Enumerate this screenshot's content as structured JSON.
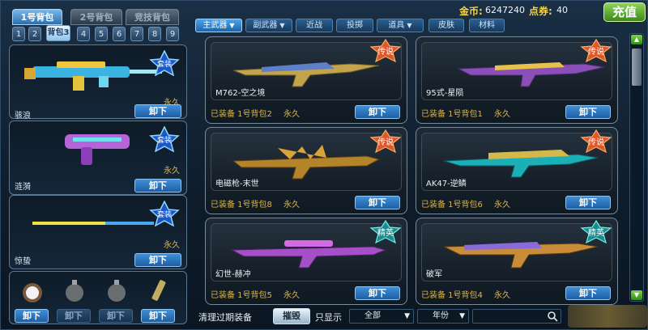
{
  "bag_tabs": [
    "1号背包",
    "2号背包",
    "竞技背包"
  ],
  "num_tabs": [
    "1",
    "2",
    "背包3",
    "4",
    "5",
    "6",
    "7",
    "8",
    "9"
  ],
  "header": {
    "gold_label": "金币:",
    "gold_value": "6247240",
    "points_label": "点券:",
    "points_value": "40",
    "recharge_label": "充值"
  },
  "category_tabs": [
    "主武器",
    "副武器",
    "近战",
    "投掷",
    "道具",
    "皮肤",
    "材料"
  ],
  "left_slots": [
    {
      "name": "骇浪",
      "durability": "永久",
      "badge": "套装",
      "button": "卸下"
    },
    {
      "name": "涟漪",
      "durability": "永久",
      "badge": "套装",
      "button": "卸下"
    },
    {
      "name": "惊蛰",
      "durability": "永久",
      "badge": "套装",
      "button": "卸下"
    }
  ],
  "throw_buttons": [
    "卸下",
    "卸下",
    "卸下",
    "卸下"
  ],
  "cards": [
    {
      "name": "M762-空之境",
      "equipped": "已装备  1号背包2",
      "durability": "永久",
      "rank": "传说",
      "button": "卸下"
    },
    {
      "name": "95式-星陨",
      "equipped": "已装备  1号背包1",
      "durability": "永久",
      "rank": "传说",
      "button": "卸下"
    },
    {
      "name": "电磁枪-末世",
      "equipped": "已装备  1号背包8",
      "durability": "永久",
      "rank": "传说",
      "button": "卸下"
    },
    {
      "name": "AK47-逆鳞",
      "equipped": "已装备  1号背包6",
      "durability": "永久",
      "rank": "传说",
      "button": "卸下"
    },
    {
      "name": "幻世-赫冲",
      "equipped": "已装备  1号背包5",
      "durability": "永久",
      "rank": "精英",
      "button": "卸下"
    },
    {
      "name": "破军",
      "equipped": "已装备  1号背包4",
      "durability": "永久",
      "rank": "精英",
      "button": "卸下"
    }
  ],
  "bottom": {
    "clear_label": "清理过期装备",
    "destroy_label": "摧毁",
    "show_label": "只显示",
    "filter1": "全部",
    "filter2": "年份",
    "search_placeholder": ""
  },
  "colors": {
    "gold": "#e3b53f",
    "accent_blue": "#3e8fd8",
    "legend_orange": "#e0552a",
    "elite_cyan": "#2fd3d0"
  }
}
